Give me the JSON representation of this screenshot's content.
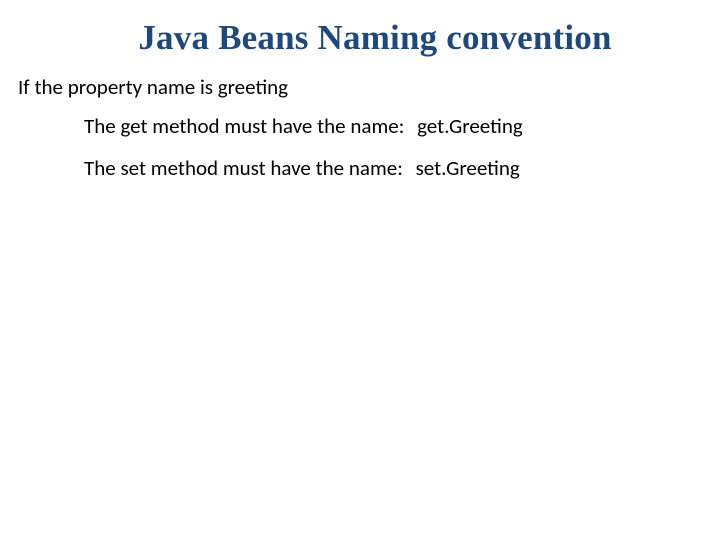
{
  "slide": {
    "title": "Java Beans Naming convention",
    "intro": "If the property name is greeting",
    "rules": [
      {
        "prefix": "The get method must have the name:",
        "value": "get.Greeting"
      },
      {
        "prefix": "The set method must have the name:",
        "value": " set.Greeting"
      }
    ]
  }
}
